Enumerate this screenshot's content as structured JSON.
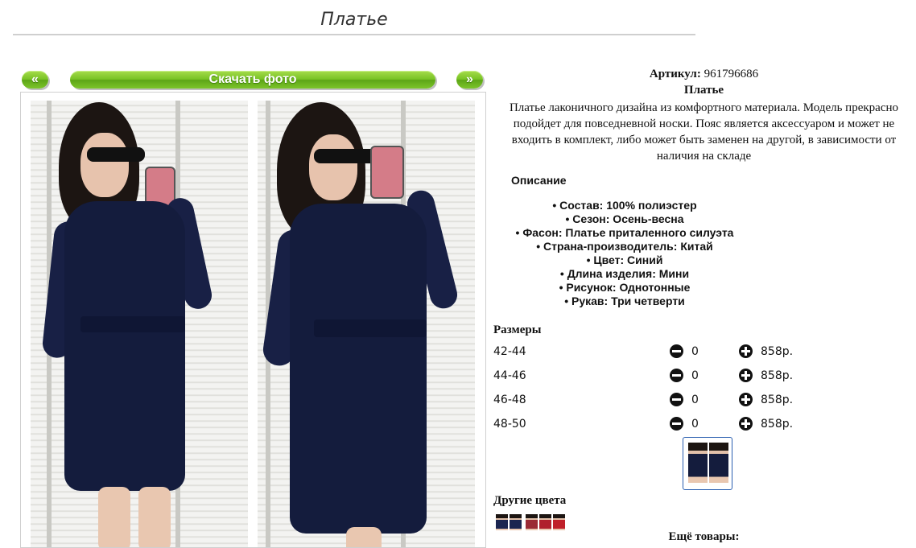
{
  "page": {
    "title": "Платье"
  },
  "nav": {
    "prev": "«",
    "download": "Скачать фото",
    "next": "»"
  },
  "product": {
    "sku_label": "Артикул:",
    "sku": "961796686",
    "name": "Платье",
    "description": "Платье лаконичного дизайна из комфортного материала. Модель прекрасно подойдет для повседневной носки. Пояс является аксессуаром и может не входить в комплект, либо может быть заменен на другой, в зависимости от наличия на складе",
    "description_heading": "Описание",
    "specs": [
      "Состав: 100% полиэстер",
      "Сезон: Осень-весна",
      "Фасон: Платье приталенного силуэта",
      "Страна-производитель: Китай",
      "Цвет: Синий",
      "Длина изделия: Мини",
      "Рисунок: Однотонные",
      "Рукав: Три четверти"
    ]
  },
  "sizes": {
    "heading": "Размеры",
    "rows": [
      {
        "size": "42-44",
        "qty": "0",
        "price": "858р."
      },
      {
        "size": "44-46",
        "qty": "0",
        "price": "858р."
      },
      {
        "size": "46-48",
        "qty": "0",
        "price": "858р."
      },
      {
        "size": "48-50",
        "qty": "0",
        "price": "858р."
      }
    ]
  },
  "other_colors": {
    "heading": "Другие цвета",
    "swatches": [
      "#1b2550",
      "#1b2550",
      "#9b2a35",
      "#b0202c",
      "#c0202a"
    ]
  },
  "more": {
    "heading": "Ещё товары:"
  }
}
